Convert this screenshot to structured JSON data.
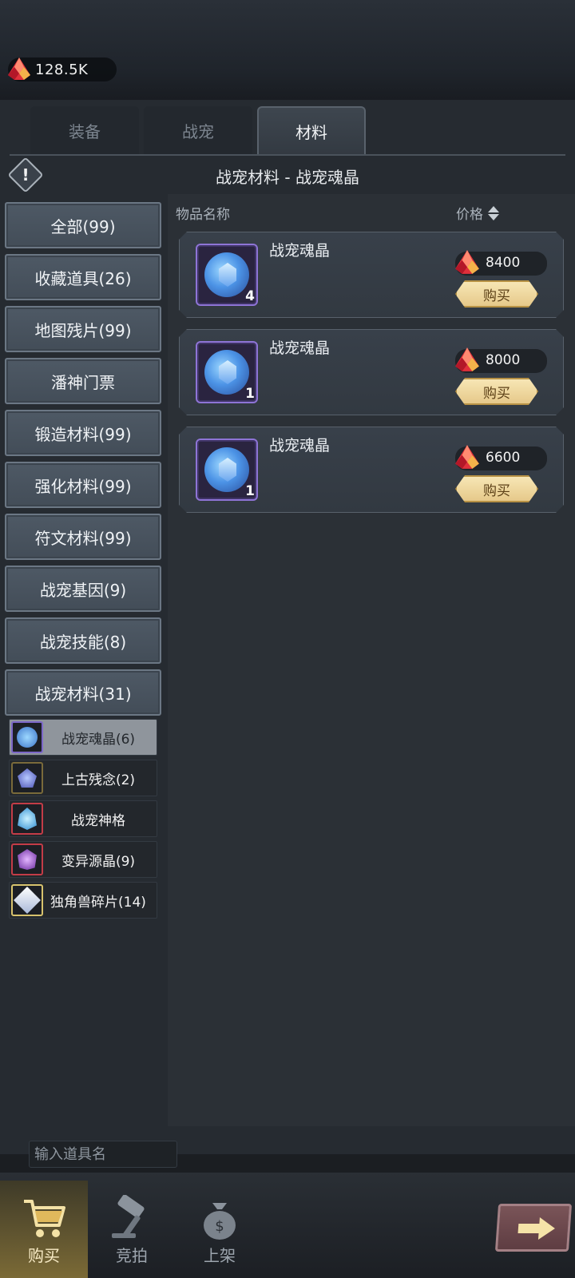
{
  "currency": {
    "icon": "ruby-gem-icon",
    "amount": "128.5K"
  },
  "tabs": [
    {
      "label": "装备",
      "active": false
    },
    {
      "label": "战宠",
      "active": false
    },
    {
      "label": "材料",
      "active": true
    }
  ],
  "subheader": {
    "title": "战宠材料 - 战宠魂晶"
  },
  "categories": [
    {
      "label": "全部(99)"
    },
    {
      "label": "收藏道具(26)"
    },
    {
      "label": "地图残片(99)"
    },
    {
      "label": "潘神门票"
    },
    {
      "label": "锻造材料(99)"
    },
    {
      "label": "强化材料(99)"
    },
    {
      "label": "符文材料(99)"
    },
    {
      "label": "战宠基因(9)"
    },
    {
      "label": "战宠技能(8)"
    },
    {
      "label": "战宠材料(31)"
    }
  ],
  "subcategories": [
    {
      "label": "战宠魂晶(6)",
      "active": true,
      "icon": "soul-crystal-icon"
    },
    {
      "label": "上古残念(2)",
      "active": false,
      "icon": "ancient-remnant-icon"
    },
    {
      "label": "战宠神格",
      "active": false,
      "icon": "divinity-icon"
    },
    {
      "label": "变异源晶(9)",
      "active": false,
      "icon": "mutation-crystal-icon"
    },
    {
      "label": "独角兽碎片(14)",
      "active": false,
      "icon": "unicorn-shard-icon"
    }
  ],
  "list": {
    "col_name": "物品名称",
    "col_price": "价格",
    "items": [
      {
        "name": "战宠魂晶",
        "qty": "4",
        "price": "8400",
        "buy_label": "购买"
      },
      {
        "name": "战宠魂晶",
        "qty": "1",
        "price": "8000",
        "buy_label": "购买"
      },
      {
        "name": "战宠魂晶",
        "qty": "1",
        "price": "6600",
        "buy_label": "购买"
      }
    ]
  },
  "search": {
    "placeholder": "输入道具名"
  },
  "bottom_nav": [
    {
      "label": "购买",
      "icon": "cart-icon",
      "active": true
    },
    {
      "label": "竞拍",
      "icon": "gavel-icon",
      "active": false
    },
    {
      "label": "上架",
      "icon": "money-bag-icon",
      "active": false
    }
  ],
  "colors": {
    "accent_gold": "#e6c98a",
    "panel": "#262b31",
    "gem_red": "#d8283a"
  }
}
